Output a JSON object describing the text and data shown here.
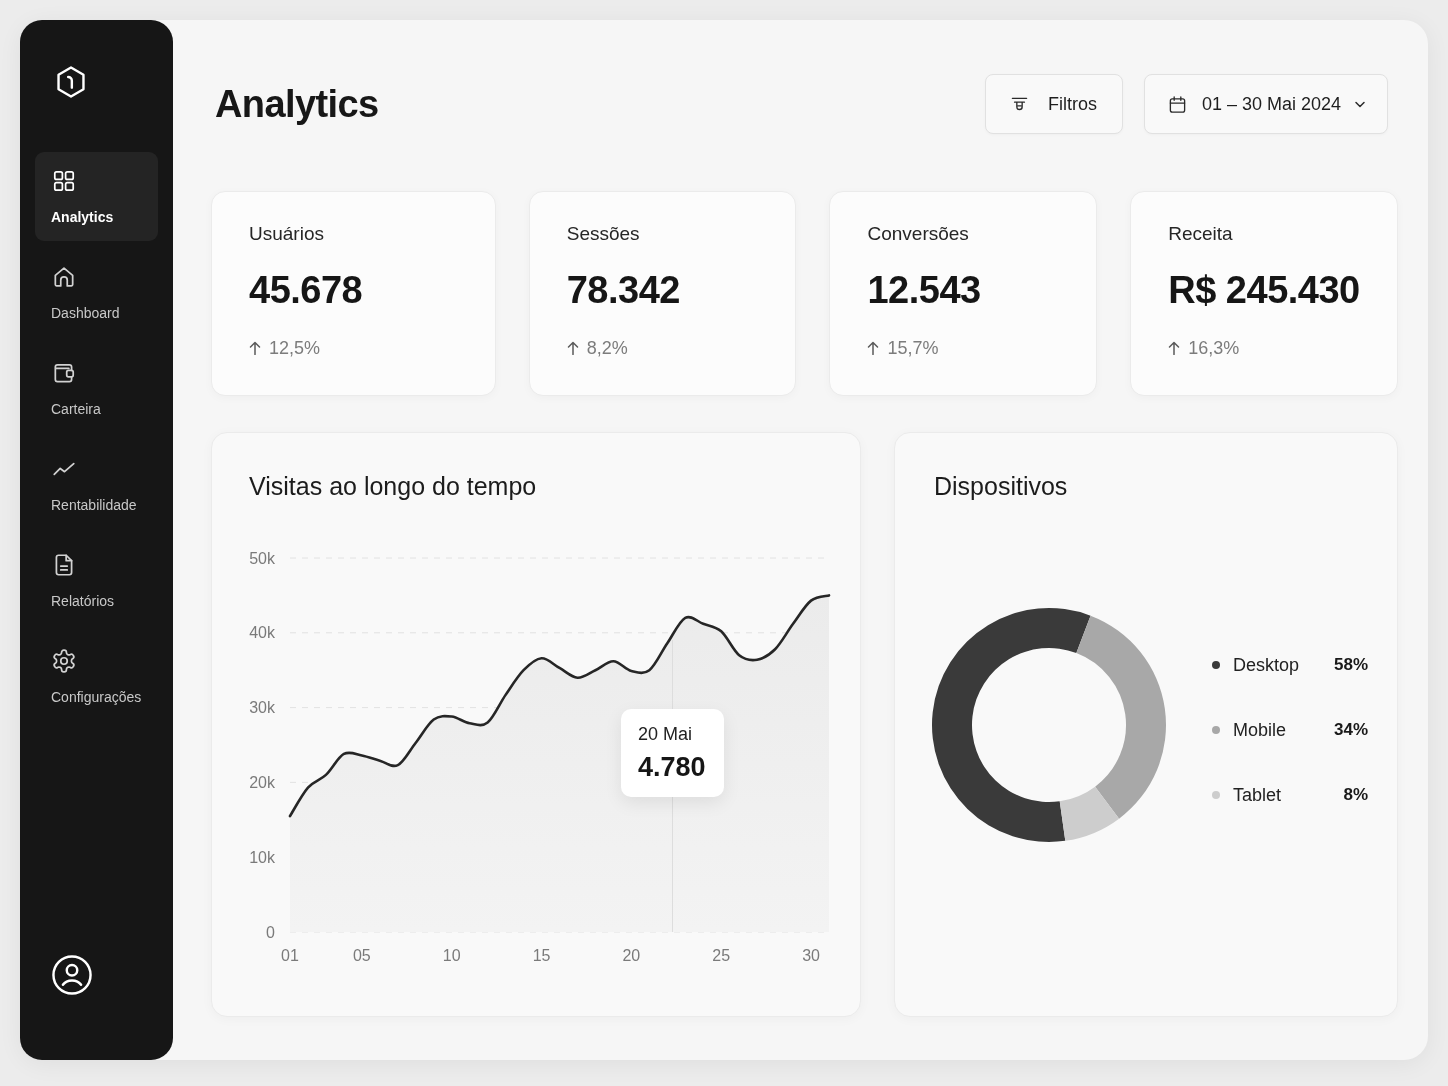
{
  "sidebar": {
    "items": [
      {
        "label": "Analytics",
        "selected": true
      },
      {
        "label": "Dashboard",
        "selected": false
      },
      {
        "label": "Carteira",
        "selected": false
      },
      {
        "label": "Rentabilidade",
        "selected": false
      },
      {
        "label": "Relatórios",
        "selected": false
      },
      {
        "label": "Configurações",
        "selected": false
      }
    ]
  },
  "header": {
    "title": "Analytics",
    "filter_button": {
      "label": "Filtros"
    },
    "date_button": {
      "label": "01 – 30 Mai 2024"
    }
  },
  "kpi_cards": [
    {
      "label": "Usuários",
      "value": "45.678",
      "change": "12,5%",
      "increase": true
    },
    {
      "label": "Sessões",
      "value": "78.342",
      "change": "8,2%",
      "increase": true
    },
    {
      "label": "Conversões",
      "value": "12.543",
      "change": "15,7%",
      "increase": true
    },
    {
      "label": "Receita",
      "value": "R$ 245.430",
      "change": "16,3%",
      "increase": true
    }
  ],
  "visits_chart": {
    "title": "Visitas ao longo do tempo",
    "chart_data": {
      "type": "area",
      "x": [
        1,
        2,
        3,
        4,
        5,
        6,
        7,
        8,
        9,
        10,
        11,
        12,
        13,
        14,
        15,
        16,
        17,
        18,
        19,
        20,
        21,
        22,
        23,
        24,
        25,
        26,
        27,
        28,
        29,
        30,
        31
      ],
      "series": [
        {
          "values": [
            15500,
            19300,
            21000,
            23800,
            23600,
            22900,
            22300,
            25300,
            28400,
            28800,
            27900,
            28000,
            31700,
            35000,
            36600,
            35300,
            34000,
            35000,
            36200,
            34900,
            35000,
            38600,
            42000,
            41200,
            40200,
            37000,
            36400,
            37800,
            41200,
            44300,
            45000
          ]
        }
      ],
      "xlim": [
        1,
        31
      ],
      "ylim": [
        0,
        50000
      ],
      "xticks": [
        {
          "value": 1,
          "label": "01"
        },
        {
          "value": 5,
          "label": "05"
        },
        {
          "value": 10,
          "label": "10"
        },
        {
          "value": 15,
          "label": "15"
        },
        {
          "value": 20,
          "label": "20"
        },
        {
          "value": 25,
          "label": "25"
        },
        {
          "value": 30,
          "label": "30"
        }
      ],
      "yticks": [
        {
          "value": 0,
          "label": "0"
        },
        {
          "value": 10000,
          "label": "10k"
        },
        {
          "value": 20000,
          "label": "20k"
        },
        {
          "value": 30000,
          "label": "30k"
        },
        {
          "value": 40000,
          "label": "40k"
        },
        {
          "value": 50000,
          "label": "50k"
        }
      ],
      "grid": true
    },
    "tooltip": {
      "date": "20 Mai",
      "value": "4.780"
    }
  },
  "devices": {
    "title": "Dispositivos",
    "chart_data": {
      "type": "donut",
      "values": [
        58,
        34,
        8
      ]
    },
    "legend": [
      {
        "label": "Desktop",
        "value": "58%",
        "color": "#3a3a3a"
      },
      {
        "label": "Mobile",
        "value": "34%",
        "color": "#a8a8a8"
      },
      {
        "label": "Tablet",
        "value": "8%",
        "color": "#cdcdcd"
      }
    ]
  }
}
